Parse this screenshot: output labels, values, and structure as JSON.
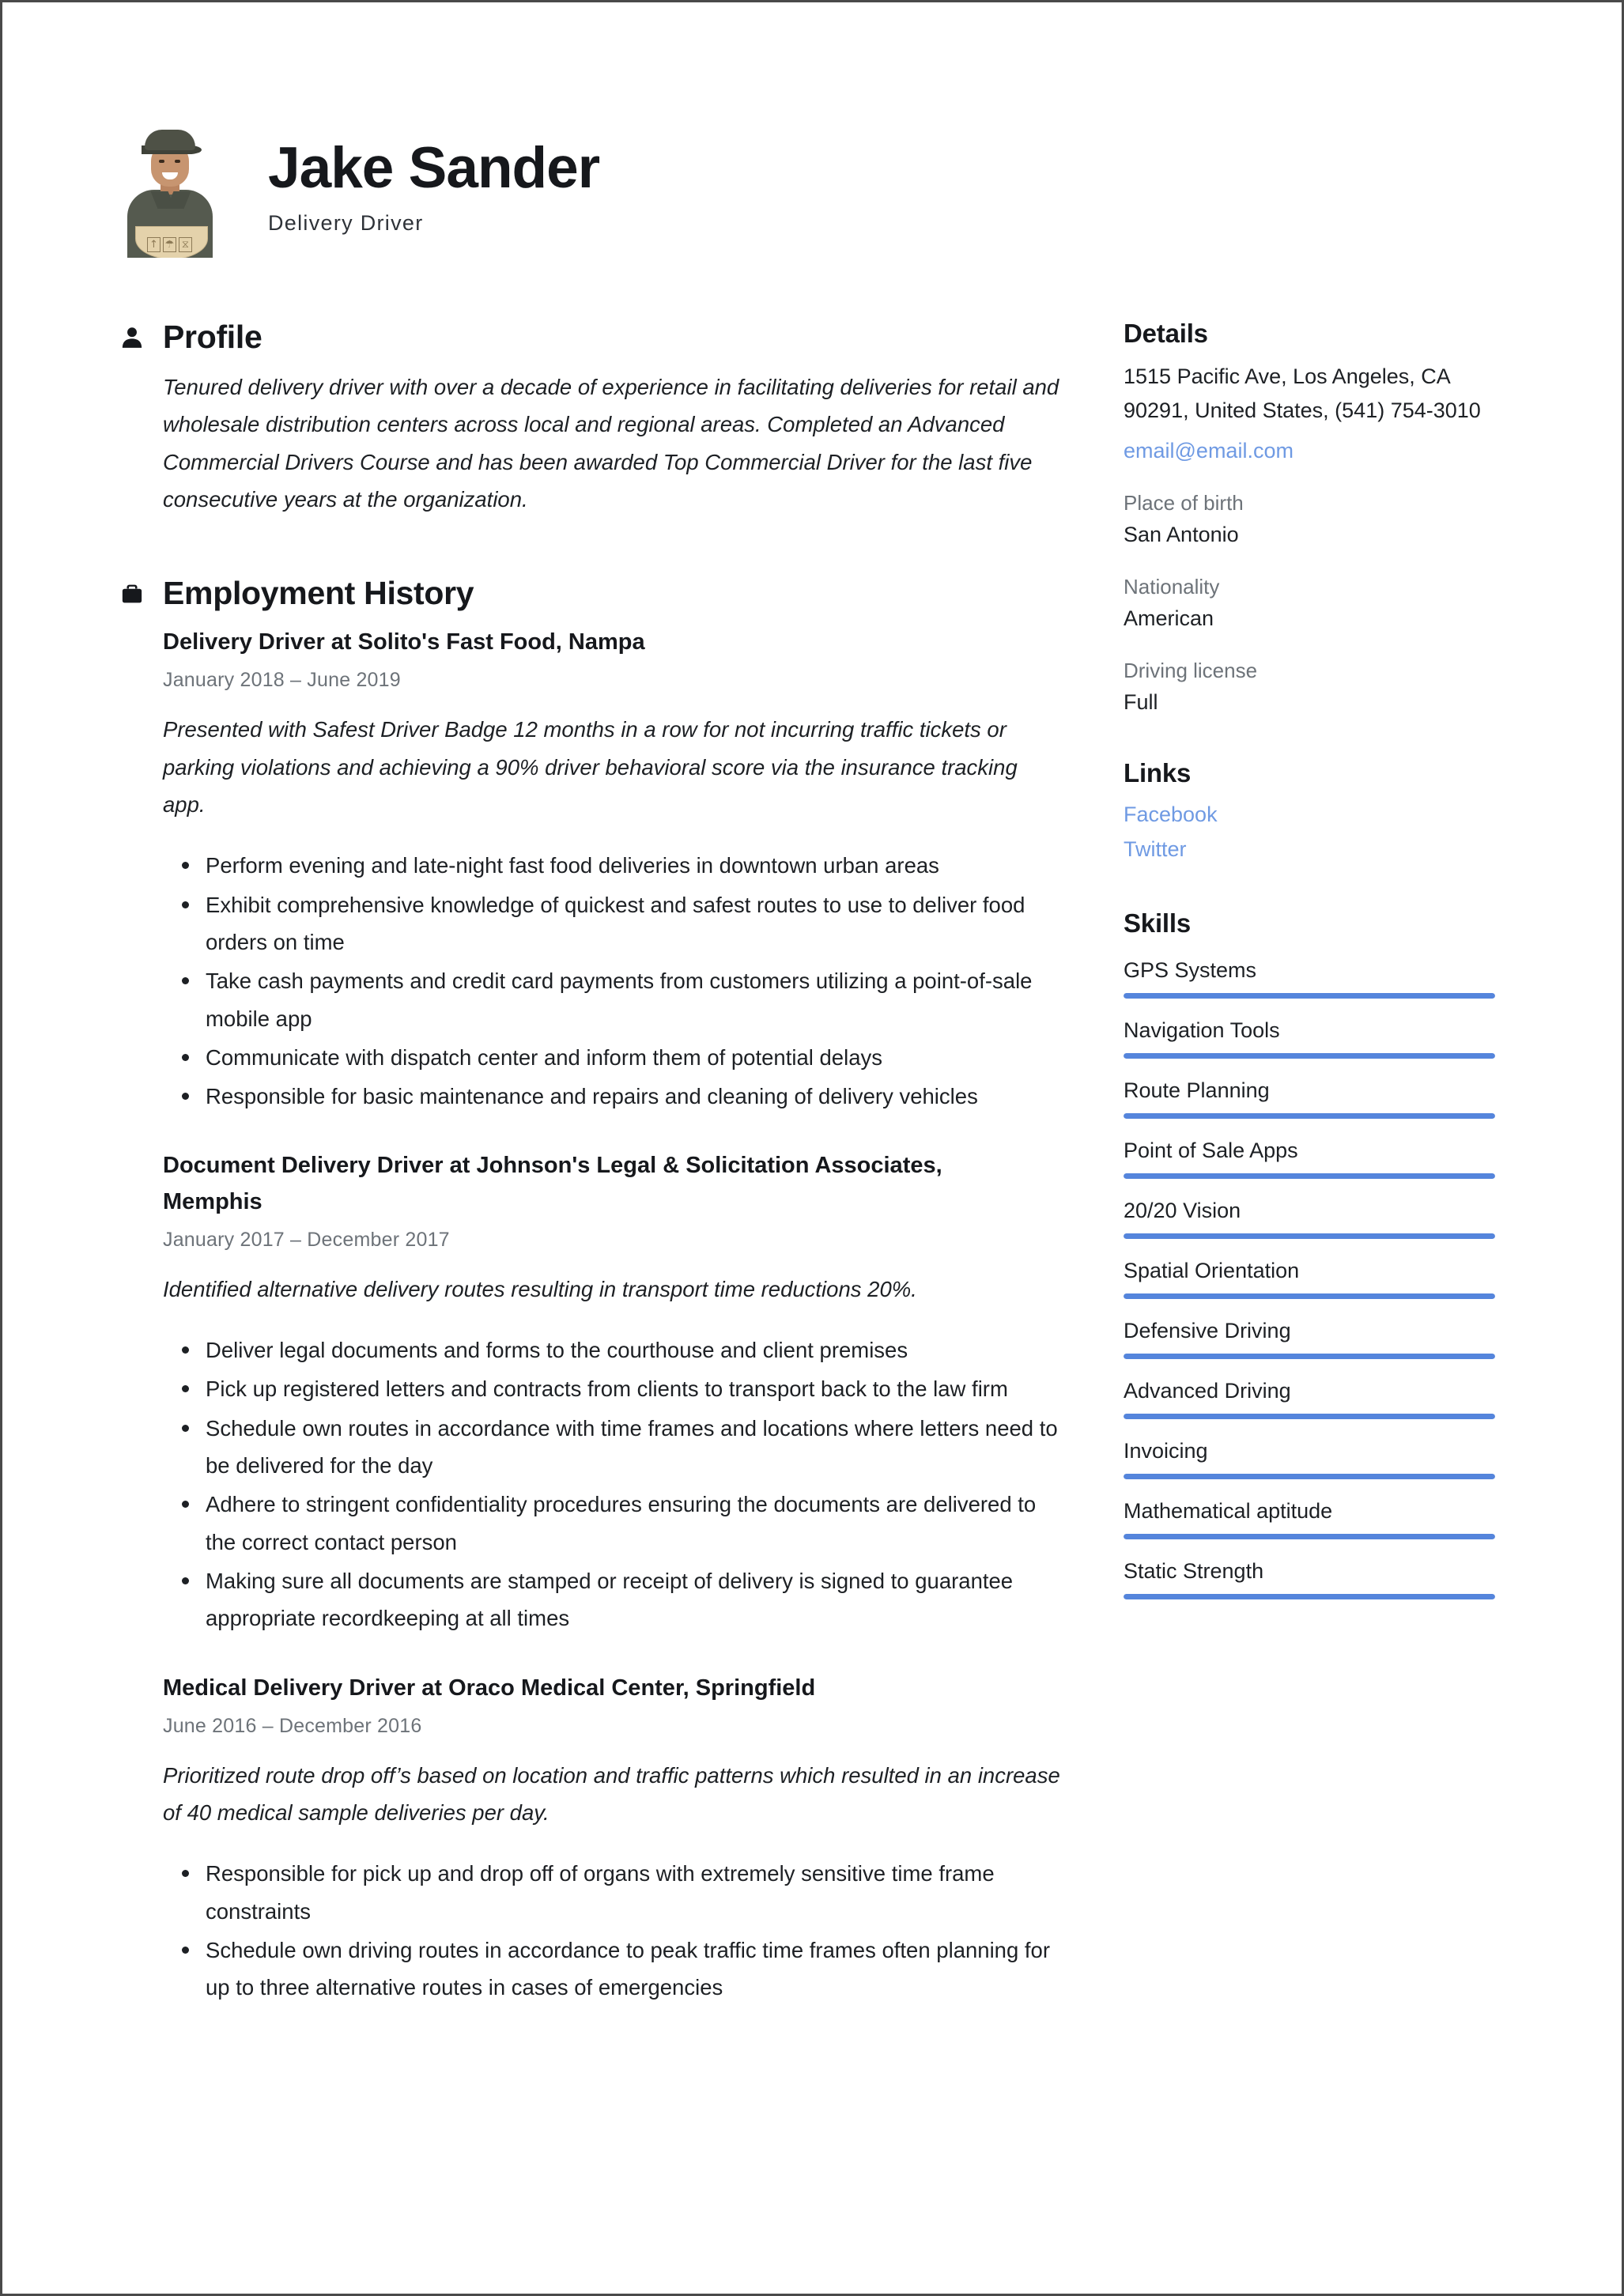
{
  "header": {
    "name": "Jake Sander",
    "job_title": "Delivery Driver",
    "photo_alt": "delivery-driver-portrait"
  },
  "sections": {
    "profile_heading": "Profile",
    "employment_heading": "Employment History"
  },
  "profile": {
    "text": "Tenured delivery driver with over a decade of experience in facilitating deliveries for retail and wholesale distribution centers across local and regional areas. Completed an Advanced Commercial Drivers Course and has been awarded Top Commercial Driver for the last five consecutive years at the organization."
  },
  "employment": [
    {
      "title": "Delivery Driver at Solito's Fast Food, Nampa",
      "dates": "January 2018  –  June 2019",
      "summary": "Presented with Safest Driver Badge 12 months in a row for not incurring traffic tickets or parking violations and achieving a 90% driver behavioral score via the insurance tracking app.",
      "bullets": [
        "Perform evening and late-night fast food deliveries in downtown urban areas",
        "Exhibit comprehensive knowledge of quickest and safest routes to use to deliver food orders on time",
        "Take cash payments and credit card payments from customers utilizing a point-of-sale mobile app",
        "Communicate with dispatch center and inform them of potential delays",
        "Responsible for basic maintenance and repairs and cleaning of delivery vehicles"
      ]
    },
    {
      "title": "Document Delivery Driver at Johnson's Legal & Solicitation Associates, Memphis",
      "dates": "January 2017  –  December 2017",
      "summary": "Identified alternative delivery routes resulting in transport time reductions 20%.",
      "bullets": [
        "Deliver legal documents and forms to the courthouse and client premises",
        "Pick up registered letters and contracts from clients to transport back to the law firm",
        "Schedule own routes in accordance with time frames and locations where letters need to be delivered for the day",
        "Adhere to stringent confidentiality procedures ensuring the documents are delivered to the correct contact person",
        "Making sure all documents are stamped or receipt of delivery is signed to guarantee appropriate recordkeeping at all times"
      ]
    },
    {
      "title": "Medical Delivery Driver at Oraco Medical Center, Springfield",
      "dates": "June 2016  –  December 2016",
      "summary": "Prioritized route drop off’s based on location and traffic patterns which resulted in an increase of 40 medical sample deliveries per day.",
      "bullets": [
        "Responsible for pick up and drop off of organs with extremely sensitive time frame constraints",
        "Schedule own driving routes in accordance to peak traffic time frames often planning for up to three alternative routes in cases of emergencies"
      ]
    }
  ],
  "details": {
    "heading": "Details",
    "address": "1515 Pacific Ave, Los Angeles, CA 90291, United States, (541) 754-3010",
    "email": "email@email.com",
    "fields": [
      {
        "label": "Place of birth",
        "value": "San Antonio"
      },
      {
        "label": "Nationality",
        "value": "American"
      },
      {
        "label": "Driving license",
        "value": "Full"
      }
    ]
  },
  "links": {
    "heading": "Links",
    "items": [
      {
        "label": "Facebook"
      },
      {
        "label": "Twitter"
      }
    ]
  },
  "skills": {
    "heading": "Skills",
    "items": [
      {
        "name": "GPS Systems",
        "level": 100
      },
      {
        "name": "Navigation Tools",
        "level": 100
      },
      {
        "name": "Route Planning",
        "level": 100
      },
      {
        "name": "Point of Sale Apps",
        "level": 100
      },
      {
        "name": "20/20 Vision",
        "level": 100
      },
      {
        "name": "Spatial Orientation",
        "level": 100
      },
      {
        "name": "Defensive Driving",
        "level": 100
      },
      {
        "name": "Advanced Driving",
        "level": 100
      },
      {
        "name": "Invoicing",
        "level": 100
      },
      {
        "name": "Mathematical aptitude",
        "level": 100
      },
      {
        "name": "Static Strength",
        "level": 100
      }
    ]
  },
  "colors": {
    "accent_blue": "#5585dc",
    "link_blue": "#6f9ae3",
    "text_dark": "#1d2024",
    "text_muted": "#6d7379"
  },
  "photo_marks": [
    "↑",
    "☂",
    "⧖"
  ]
}
